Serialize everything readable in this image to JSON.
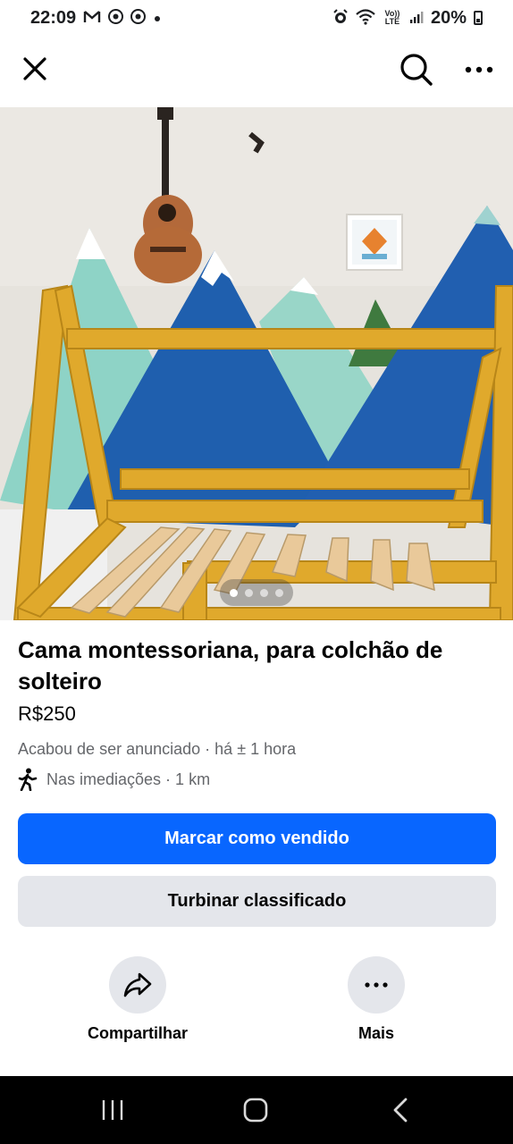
{
  "status_bar": {
    "time": "22:09",
    "notification_icons": [
      "gmail-icon",
      "chrome-icon",
      "chrome-icon",
      "dot-icon"
    ],
    "system_icons": [
      "alarm-icon",
      "wifi-icon",
      "volte-icon",
      "signal-icon"
    ],
    "volte_label": "Vo)) LTE",
    "battery": "20%"
  },
  "app_bar": {
    "icons": [
      "close-icon",
      "search-icon",
      "more-horizontal-icon"
    ]
  },
  "photo": {
    "dots_total": 4,
    "dots_active": 1
  },
  "listing": {
    "title": "Cama montessoriana, para colchão de solteiro",
    "price": "R$250",
    "posted": "Acabou de ser anunciado",
    "time_ago": "· há ± 1 hora",
    "location": "Nas imediações · 1 km"
  },
  "buttons": {
    "primary": "Marcar como vendido",
    "secondary": "Turbinar classificado"
  },
  "actions": {
    "share": "Compartilhar",
    "more": "Mais"
  },
  "colors": {
    "accent": "#0866ff",
    "secondary_bg": "#e4e6eb",
    "meta_text": "#65676b"
  }
}
